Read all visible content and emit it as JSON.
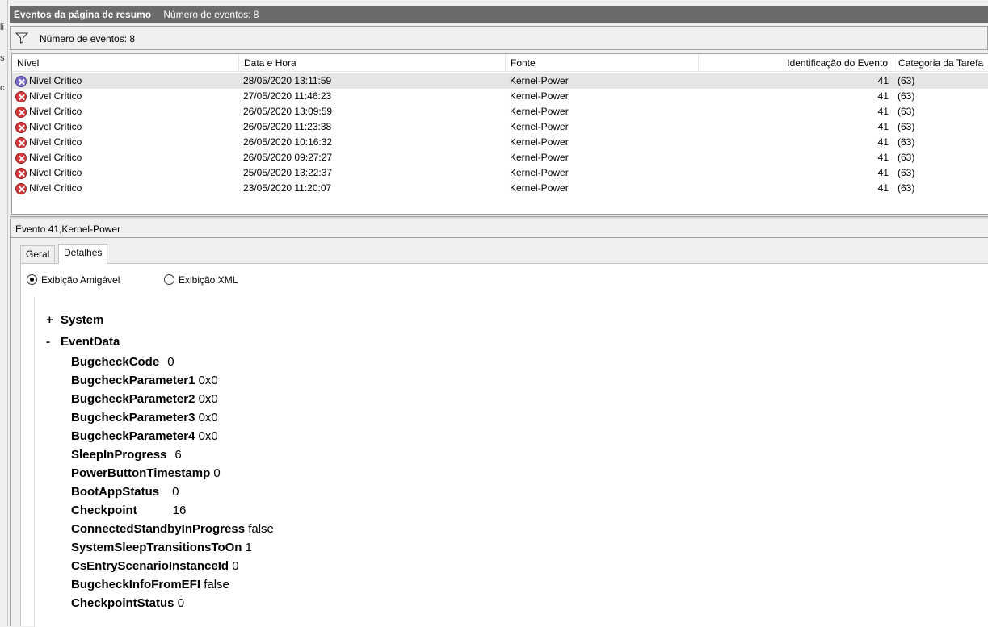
{
  "left_strip": {
    "frags": [
      "li",
      "s",
      "c"
    ]
  },
  "title_bar": {
    "title": "Eventos da página de resumo",
    "count_text": "Número de eventos: 8"
  },
  "filter_bar": {
    "icon": "funnel-icon",
    "label": "Número de eventos: 8"
  },
  "grid": {
    "columns": [
      "Nível",
      "Data e Hora",
      "Fonte",
      "Identificação do Evento",
      "Categoria da Tarefa"
    ],
    "rows": [
      {
        "level": "Nível Crítico",
        "datetime": "28/05/2020 13:11:59",
        "source": "Kernel-Power",
        "event_id": "41",
        "category": "(63)",
        "selected": true
      },
      {
        "level": "Nível Crítico",
        "datetime": "27/05/2020 11:46:23",
        "source": "Kernel-Power",
        "event_id": "41",
        "category": "(63)"
      },
      {
        "level": "Nível Crítico",
        "datetime": "26/05/2020 13:09:59",
        "source": "Kernel-Power",
        "event_id": "41",
        "category": "(63)"
      },
      {
        "level": "Nível Crítico",
        "datetime": "26/05/2020 11:23:38",
        "source": "Kernel-Power",
        "event_id": "41",
        "category": "(63)"
      },
      {
        "level": "Nível Crítico",
        "datetime": "26/05/2020 10:16:32",
        "source": "Kernel-Power",
        "event_id": "41",
        "category": "(63)"
      },
      {
        "level": "Nível Crítico",
        "datetime": "26/05/2020 09:27:27",
        "source": "Kernel-Power",
        "event_id": "41",
        "category": "(63)"
      },
      {
        "level": "Nível Crítico",
        "datetime": "25/05/2020 13:22:37",
        "source": "Kernel-Power",
        "event_id": "41",
        "category": "(63)"
      },
      {
        "level": "Nível Crítico",
        "datetime": "23/05/2020 11:20:07",
        "source": "Kernel-Power",
        "event_id": "41",
        "category": "(63)"
      }
    ]
  },
  "detail": {
    "event_title": "Evento 41,Kernel-Power",
    "tabs": [
      {
        "label": "Geral"
      },
      {
        "label": "Detalhes",
        "active": true
      }
    ],
    "view_options": [
      {
        "label": "Exibição Amigável",
        "checked": true
      },
      {
        "label": "Exibição XML",
        "checked": false
      }
    ],
    "system_node": {
      "toggle": "+",
      "name": "System"
    },
    "eventdata_node": {
      "toggle": "-",
      "name": "EventData"
    },
    "event_data": [
      {
        "key": "BugcheckCode",
        "value": "0"
      },
      {
        "key": "BugcheckParameter1",
        "value": "0x0"
      },
      {
        "key": "BugcheckParameter2",
        "value": "0x0"
      },
      {
        "key": "BugcheckParameter3",
        "value": "0x0"
      },
      {
        "key": "BugcheckParameter4",
        "value": "0x0"
      },
      {
        "key": "SleepInProgress",
        "value": "6"
      },
      {
        "key": "PowerButtonTimestamp",
        "value": "0"
      },
      {
        "key": "BootAppStatus",
        "value": "0"
      },
      {
        "key": "Checkpoint",
        "value": "16"
      },
      {
        "key": "ConnectedStandbyInProgress",
        "value": "false"
      },
      {
        "key": "SystemSleepTransitionsToOn",
        "value": "1"
      },
      {
        "key": "CsEntryScenarioInstanceId",
        "value": "0"
      },
      {
        "key": "BugcheckInfoFromEFI",
        "value": "false"
      },
      {
        "key": "CheckpointStatus",
        "value": "0"
      }
    ]
  }
}
